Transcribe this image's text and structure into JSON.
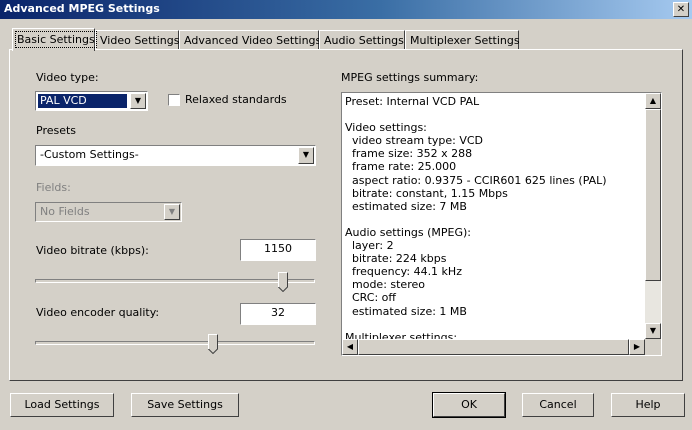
{
  "window": {
    "title": "Advanced MPEG Settings",
    "close_glyph": "✕"
  },
  "tabs": [
    {
      "label": "Basic Settings",
      "active": true
    },
    {
      "label": "Video Settings",
      "active": false
    },
    {
      "label": "Advanced Video Settings",
      "active": false
    },
    {
      "label": "Audio Settings",
      "active": false
    },
    {
      "label": "Multiplexer Settings",
      "active": false
    }
  ],
  "basic": {
    "video_type_label": "Video type:",
    "video_type_value": "PAL VCD",
    "relaxed_label": "Relaxed standards",
    "relaxed_checked": false,
    "presets_label": "Presets",
    "presets_value": "-Custom Settings-",
    "fields_label": "Fields:",
    "fields_value": "No Fields",
    "bitrate_label": "Video bitrate (kbps):",
    "bitrate_value": "1150",
    "bitrate_slider_fraction": 0.9,
    "quality_label": "Video encoder quality:",
    "quality_value": "32",
    "quality_slider_fraction": 0.64
  },
  "summary": {
    "label": "MPEG settings summary:",
    "lines": [
      "Preset: Internal VCD PAL",
      "",
      "Video settings:",
      "  video stream type: VCD",
      "  frame size: 352 x 288",
      "  frame rate: 25.000",
      "  aspect ratio: 0.9375 - CCIR601 625 lines (PAL)",
      "  bitrate: constant, 1.15 Mbps",
      "  estimated size: 7 MB",
      "",
      "Audio settings (MPEG):",
      "  layer: 2",
      "  bitrate: 224 kbps",
      "  frequency: 44.1 kHz",
      "  mode: stereo",
      "  CRC: off",
      "  estimated size: 1 MB",
      "",
      "Multiplexer settings:"
    ]
  },
  "buttons": {
    "load": "Load Settings",
    "save": "Save Settings",
    "ok": "OK",
    "cancel": "Cancel",
    "help": "Help"
  },
  "colors": {
    "title_start": "#0a246a",
    "title_end": "#a6caf0",
    "selection": "#0a246a",
    "face": "#d4d0c8"
  }
}
